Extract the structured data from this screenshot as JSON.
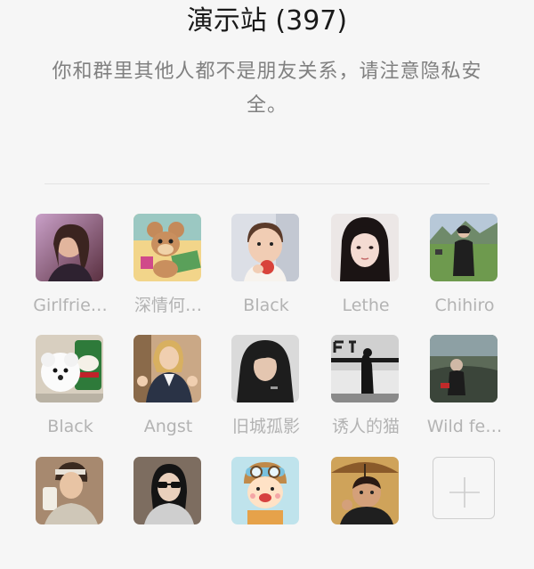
{
  "header": {
    "title": "演示站 (397)",
    "notice": "你和群里其他人都不是朋友关系，请注意隐私安全。"
  },
  "members": [
    {
      "name": "Girlfrie…",
      "icon": "woman-portrait-avatar"
    },
    {
      "name": "深情何…",
      "icon": "cartoon-mouse-avatar"
    },
    {
      "name": "Black",
      "icon": "toddler-with-apple-avatar"
    },
    {
      "name": "Lethe",
      "icon": "girl-portrait-avatar"
    },
    {
      "name": "Chihiro",
      "icon": "person-in-field-avatar"
    },
    {
      "name": "Black",
      "icon": "puppy-with-can-avatar"
    },
    {
      "name": "Angst",
      "icon": "woman-thumbs-up-avatar"
    },
    {
      "name": "旧城孤影",
      "icon": "hooded-man-avatar"
    },
    {
      "name": "诱人的猫",
      "icon": "street-scene-avatar"
    },
    {
      "name": "Wild fe…",
      "icon": "person-sitting-avatar"
    },
    {
      "name": "",
      "icon": "man-with-cup-avatar"
    },
    {
      "name": "",
      "icon": "woman-sunglasses-avatar"
    },
    {
      "name": "",
      "icon": "cartoon-pilot-avatar"
    },
    {
      "name": "",
      "icon": "man-with-umbrella-avatar"
    }
  ],
  "add_button": {
    "icon": "plus-icon"
  },
  "colors": {
    "background": "#f6f6f6",
    "title_text": "#1a1a1a",
    "notice_text": "#808080",
    "name_text": "#b3b3b3"
  }
}
